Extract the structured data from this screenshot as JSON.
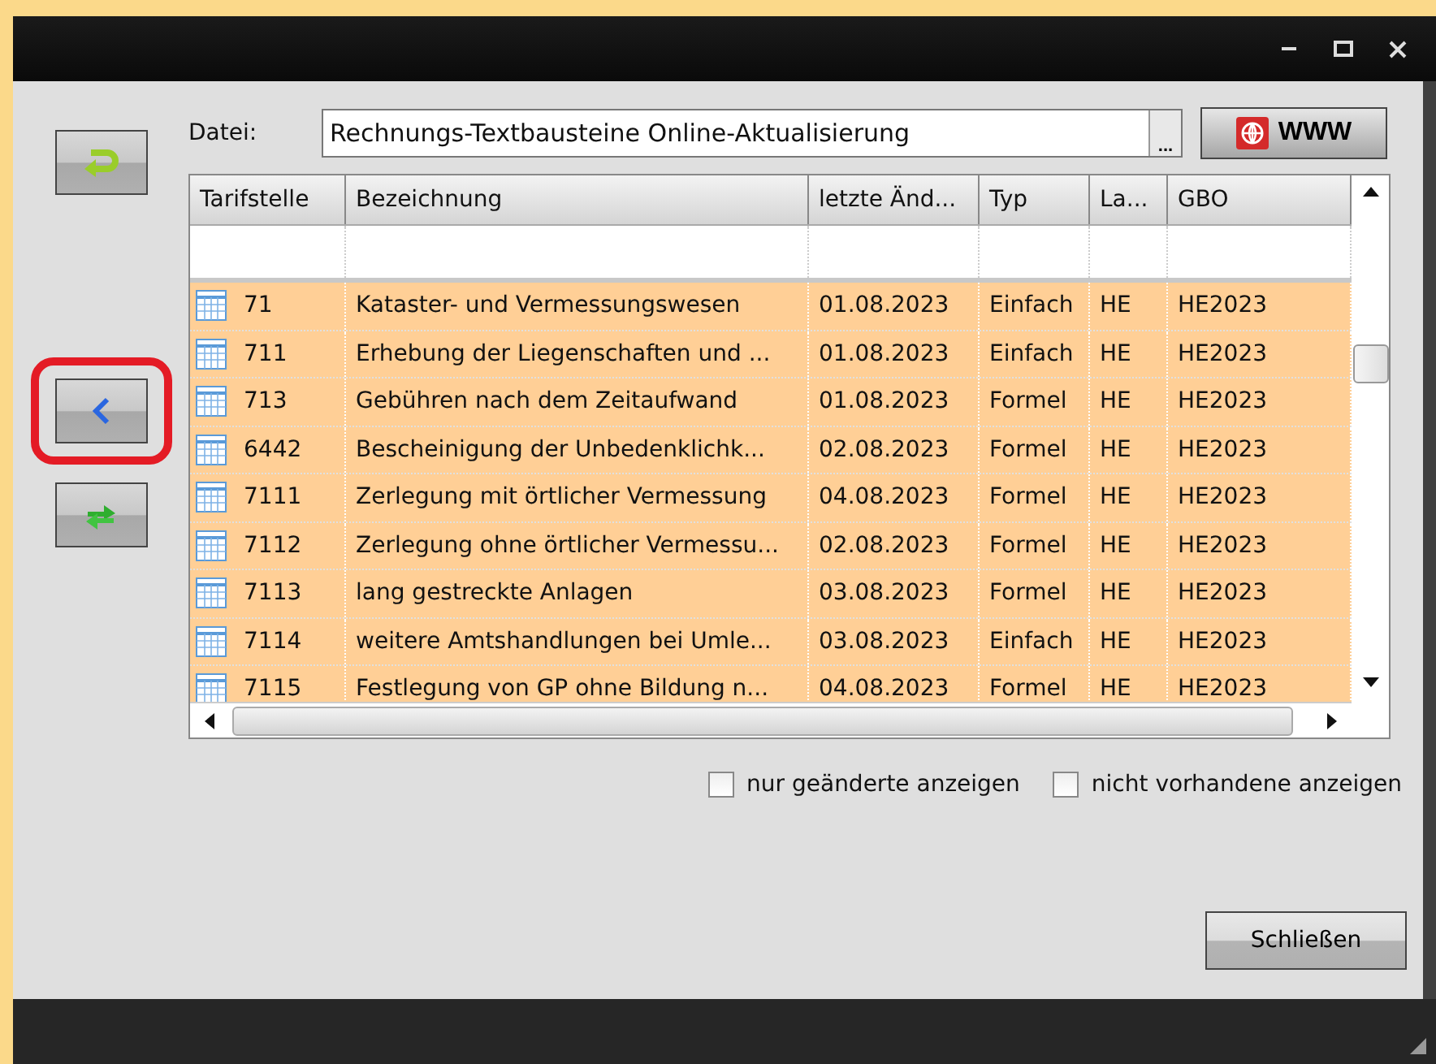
{
  "file": {
    "label": "Datei:",
    "value": "Rechnungs-Textbausteine Online-Aktualisierung",
    "browse": "...",
    "www": "WWW"
  },
  "table": {
    "columns": [
      "Tarifstelle",
      "Bezeichnung",
      "letzte Änd...",
      "Typ",
      "La...",
      "GBO"
    ],
    "rows": [
      [
        "71",
        "Kataster- und Vermessungswesen",
        "01.08.2023",
        "Einfach",
        "HE",
        "HE2023"
      ],
      [
        "711",
        "Erhebung der Liegenschaften und ...",
        "01.08.2023",
        "Einfach",
        "HE",
        "HE2023"
      ],
      [
        "713",
        "Gebühren nach dem Zeitaufwand",
        "01.08.2023",
        "Formel",
        "HE",
        "HE2023"
      ],
      [
        "6442",
        "Bescheinigung der Unbedenklichk...",
        "02.08.2023",
        "Formel",
        "HE",
        "HE2023"
      ],
      [
        "7111",
        "Zerlegung mit örtlicher Vermessung",
        "04.08.2023",
        "Formel",
        "HE",
        "HE2023"
      ],
      [
        "7112",
        "Zerlegung ohne örtlicher Vermessu...",
        "02.08.2023",
        "Formel",
        "HE",
        "HE2023"
      ],
      [
        "7113",
        "lang gestreckte Anlagen",
        "03.08.2023",
        "Formel",
        "HE",
        "HE2023"
      ],
      [
        "7114",
        "weitere Amtshandlungen bei Umle...",
        "03.08.2023",
        "Einfach",
        "HE",
        "HE2023"
      ],
      [
        "7115",
        "Festlegung von GP ohne Bildung n...",
        "04.08.2023",
        "Formel",
        "HE",
        "HE2023"
      ]
    ]
  },
  "options": [
    {
      "label": "nur geänderte anzeigen",
      "checked": false
    },
    {
      "label": "nicht vorhandene anzeigen",
      "checked": false
    }
  ],
  "close_button": "Schließen"
}
